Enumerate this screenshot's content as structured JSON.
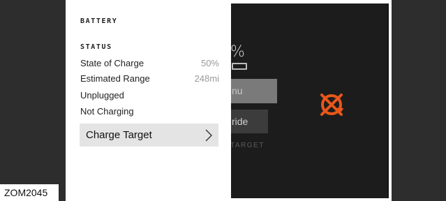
{
  "panel": {
    "title": "BATTERY",
    "status_heading": "STATUS",
    "rows": [
      {
        "label": "State of Charge",
        "value": "50%"
      },
      {
        "label": "Estimated Range",
        "value": "248mi"
      },
      {
        "label": "Unplugged",
        "value": ""
      },
      {
        "label": "Not Charging",
        "value": ""
      }
    ],
    "charge_target_label": "Charge Target"
  },
  "background": {
    "percent_text": "%",
    "menu_button_text": "nu",
    "override_button_text": "ride",
    "target_text": "TARGET",
    "icon_color": "#e8571a"
  },
  "image_label": "ZOM2045"
}
